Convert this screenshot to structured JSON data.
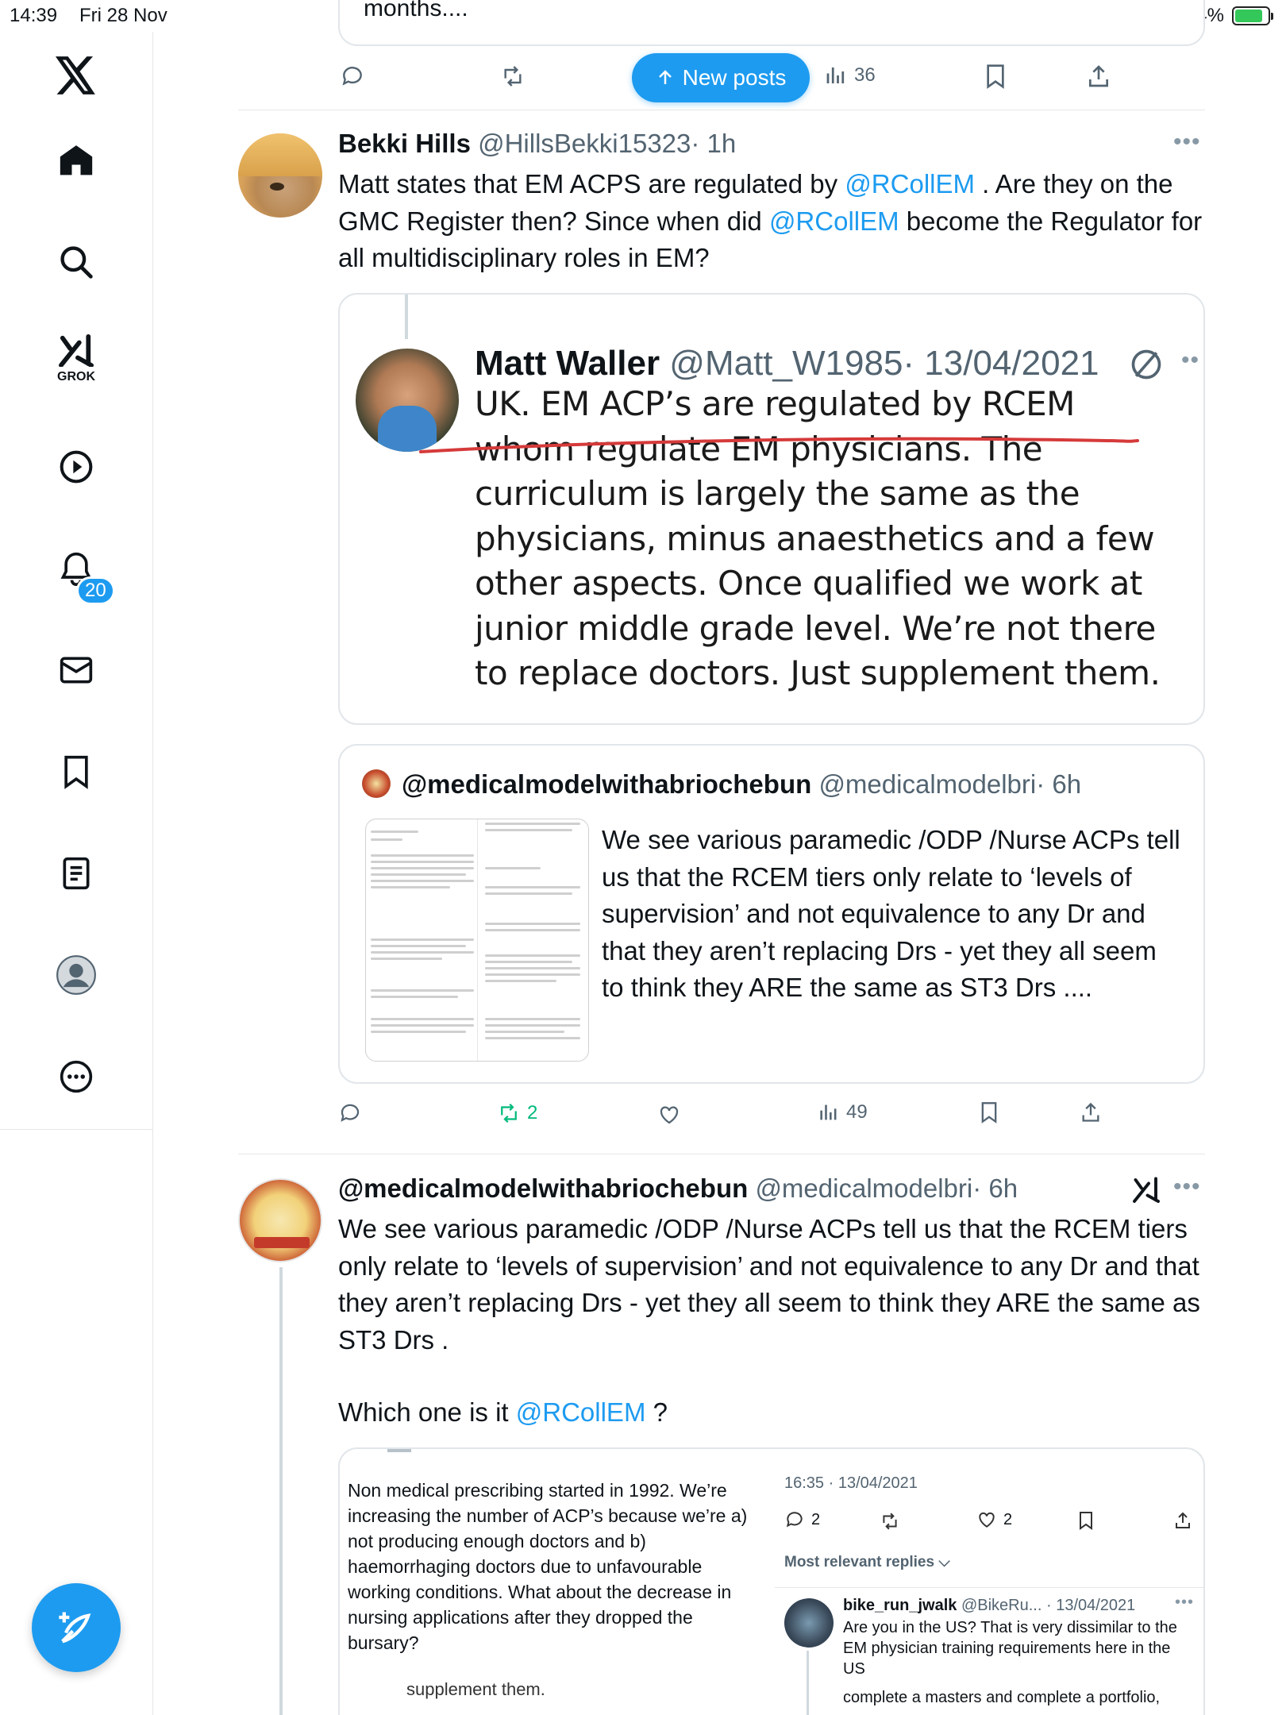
{
  "status_bar": {
    "time": "14:39",
    "date": "Fri 28 Nov",
    "battery": "84%"
  },
  "top_tweet": {
    "text_fragment": "months....",
    "views": "36"
  },
  "new_posts_label": "New posts",
  "sidebar": {
    "grok_label": "GROK",
    "notifications_badge": "20"
  },
  "tweet1": {
    "name": "Bekki Hills",
    "handle": "@HillsBekki15323",
    "time": "· 1h",
    "text_a": "Matt states that EM ACPS are regulated by ",
    "mention1": "@RCollEM",
    "text_b": " . Are they on the GMC Register then? Since when did ",
    "mention2": "@RCollEM",
    "text_c": " become the Regulator for all multidisciplinary roles in EM?",
    "quoted_image": {
      "name": "Matt Waller",
      "handle": "@Matt_W1985",
      "date": "· 13/04/2021",
      "text": "UK. EM ACP’s are regulated by RCEM whom regulate EM physicians. The curriculum is largely the same as the physicians, minus anaesthetics and a few other aspects. Once qualified we work at junior middle grade level. We’re not there to replace doctors. Just supplement them."
    },
    "quote": {
      "name": "@medicalmodelwithabriochebun",
      "handle": "@medicalmodelbri",
      "time": "· 6h",
      "text": "We see various paramedic /ODP /Nurse ACPs tell us that the RCEM tiers only relate to ‘levels of supervision’ and not equivalence to any Dr and that they aren’t replacing Drs - yet they all seem to think they ARE the same as ST3 Drs ...."
    },
    "retweets": "2",
    "views": "49"
  },
  "tweet2": {
    "name": "@medicalmodelwithabriochebun",
    "handle": "@medicalmodelbri",
    "time": "· 6h",
    "text": "We see various paramedic /ODP /Nurse ACPs tell us that the RCEM tiers only relate to ‘levels of supervision’ and not equivalence to any Dr and that they aren’t replacing Drs - yet they all seem to think they ARE the same as ST3 Drs .",
    "text2_a": "Which one is it ",
    "mention": "@RCollEM",
    "text2_b": " ?",
    "embedded": {
      "left_text": "Non medical prescribing started in 1992. We’re increasing the number of ACP’s because we’re a) not producing enough doctors and b) haemorrhaging doctors due to unfavourable working conditions. What about the decrease in nursing applications after they dropped the bursary?",
      "left_cut": "supplement them.",
      "stamp": "16:35 · 13/04/2021",
      "replies": "2",
      "likes": "2",
      "most_relevant": "Most relevant replies",
      "reply_name": "bike_run_jwalk",
      "reply_handle": "@BikeRu...",
      "reply_date": "· 13/04/2021",
      "reply_text": "Are you in the US? That is very dissimilar to the EM physician training requirements here in the US",
      "reply_text2": "complete a masters and complete a portfolio,"
    }
  }
}
